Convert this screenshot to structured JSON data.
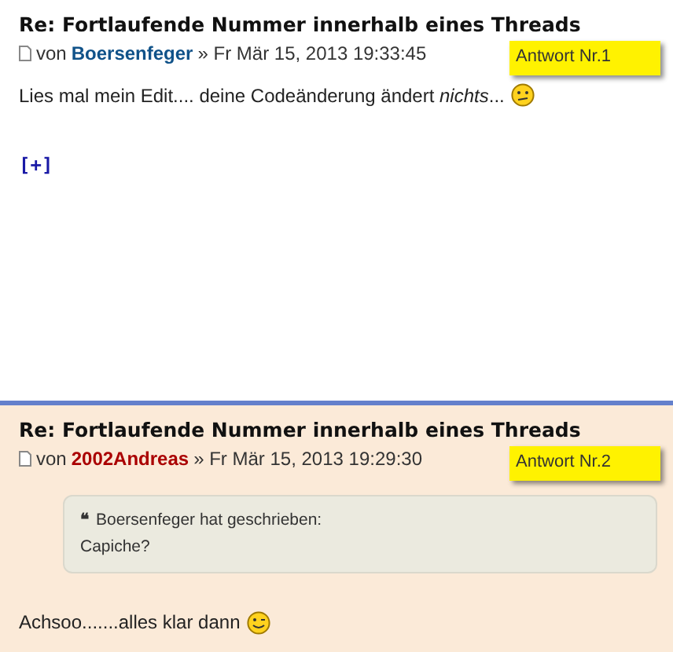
{
  "posts": [
    {
      "title": "Re: Fortlaufende Nummer innerhalb eines Threads",
      "by": "von",
      "author": "Boersenfeger",
      "color": "#105289",
      "sep": "»",
      "date": "Fr Mär 15, 2013 19:33:45",
      "note": "Antwort Nr.1",
      "text": "Lies mal mein Edit.... deine Codeänderung ändert *nichts*...",
      "kind": "confused",
      "expand": "[+]"
    },
    {
      "title": "Re: Fortlaufende Nummer innerhalb eines Threads",
      "by": "von",
      "author": "2002Andreas",
      "color": "#aa0000",
      "sep": "»",
      "date": "Fr Mär 15, 2013 19:29:30",
      "note": "Antwort Nr.2",
      "quote": {
        "mark": "❝",
        "cite": "Boersenfeger hat geschrieben:",
        "text": "Capiche?"
      },
      "text": "Achsoo.......alles klar dann",
      "kind": "wink"
    }
  ]
}
